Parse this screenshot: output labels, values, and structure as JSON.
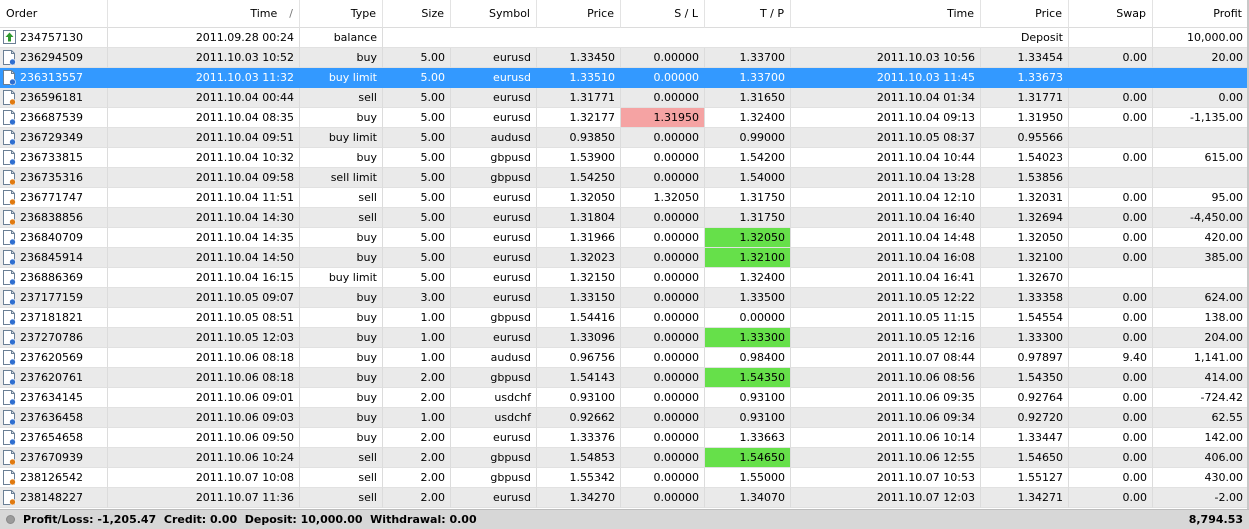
{
  "columns": {
    "order": "Order",
    "time": "Time",
    "sort_indicator": "/",
    "type": "Type",
    "size": "Size",
    "symbol": "Symbol",
    "price": "Price",
    "sl": "S / L",
    "tp": "T / P",
    "close_time": "Time",
    "close_price": "Price",
    "swap": "Swap",
    "profit": "Profit"
  },
  "rows": [
    {
      "order": "234757130",
      "time": "2011.09.28 00:24",
      "type": "balance",
      "comment": "Deposit",
      "profit": "10,000.00"
    },
    {
      "order": "236294509",
      "time": "2011.10.03 10:52",
      "type": "buy",
      "size": "5.00",
      "symbol": "eurusd",
      "price": "1.33450",
      "sl": "0.00000",
      "tp": "1.33700",
      "close_time": "2011.10.03 10:56",
      "close_price": "1.33454",
      "swap": "0.00",
      "profit": "20.00"
    },
    {
      "order": "236313557",
      "time": "2011.10.03 11:32",
      "type": "buy limit",
      "size": "5.00",
      "symbol": "eurusd",
      "price": "1.33510",
      "sl": "0.00000",
      "tp": "1.33700",
      "close_time": "2011.10.03 11:45",
      "close_price": "1.33673",
      "swap": "",
      "profit": ""
    },
    {
      "order": "236596181",
      "time": "2011.10.04 00:44",
      "type": "sell",
      "size": "5.00",
      "symbol": "eurusd",
      "price": "1.31771",
      "sl": "0.00000",
      "tp": "1.31650",
      "close_time": "2011.10.04 01:34",
      "close_price": "1.31771",
      "swap": "0.00",
      "profit": "0.00"
    },
    {
      "order": "236687539",
      "time": "2011.10.04 08:35",
      "type": "buy",
      "size": "5.00",
      "symbol": "eurusd",
      "price": "1.32177",
      "sl": "1.31950",
      "tp": "1.32400",
      "close_time": "2011.10.04 09:13",
      "close_price": "1.31950",
      "swap": "0.00",
      "profit": "-1,135.00"
    },
    {
      "order": "236729349",
      "time": "2011.10.04 09:51",
      "type": "buy limit",
      "size": "5.00",
      "symbol": "audusd",
      "price": "0.93850",
      "sl": "0.00000",
      "tp": "0.99000",
      "close_time": "2011.10.05 08:37",
      "close_price": "0.95566",
      "swap": "",
      "profit": ""
    },
    {
      "order": "236733815",
      "time": "2011.10.04 10:32",
      "type": "buy",
      "size": "5.00",
      "symbol": "gbpusd",
      "price": "1.53900",
      "sl": "0.00000",
      "tp": "1.54200",
      "close_time": "2011.10.04 10:44",
      "close_price": "1.54023",
      "swap": "0.00",
      "profit": "615.00"
    },
    {
      "order": "236735316",
      "time": "2011.10.04 09:58",
      "type": "sell limit",
      "size": "5.00",
      "symbol": "gbpusd",
      "price": "1.54250",
      "sl": "0.00000",
      "tp": "1.54000",
      "close_time": "2011.10.04 13:28",
      "close_price": "1.53856",
      "swap": "",
      "profit": ""
    },
    {
      "order": "236771747",
      "time": "2011.10.04 11:51",
      "type": "sell",
      "size": "5.00",
      "symbol": "eurusd",
      "price": "1.32050",
      "sl": "1.32050",
      "tp": "1.31750",
      "close_time": "2011.10.04 12:10",
      "close_price": "1.32031",
      "swap": "0.00",
      "profit": "95.00"
    },
    {
      "order": "236838856",
      "time": "2011.10.04 14:30",
      "type": "sell",
      "size": "5.00",
      "symbol": "eurusd",
      "price": "1.31804",
      "sl": "0.00000",
      "tp": "1.31750",
      "close_time": "2011.10.04 16:40",
      "close_price": "1.32694",
      "swap": "0.00",
      "profit": "-4,450.00"
    },
    {
      "order": "236840709",
      "time": "2011.10.04 14:35",
      "type": "buy",
      "size": "5.00",
      "symbol": "eurusd",
      "price": "1.31966",
      "sl": "0.00000",
      "tp": "1.32050",
      "close_time": "2011.10.04 14:48",
      "close_price": "1.32050",
      "swap": "0.00",
      "profit": "420.00"
    },
    {
      "order": "236845914",
      "time": "2011.10.04 14:50",
      "type": "buy",
      "size": "5.00",
      "symbol": "eurusd",
      "price": "1.32023",
      "sl": "0.00000",
      "tp": "1.32100",
      "close_time": "2011.10.04 16:08",
      "close_price": "1.32100",
      "swap": "0.00",
      "profit": "385.00"
    },
    {
      "order": "236886369",
      "time": "2011.10.04 16:15",
      "type": "buy limit",
      "size": "5.00",
      "symbol": "eurusd",
      "price": "1.32150",
      "sl": "0.00000",
      "tp": "1.32400",
      "close_time": "2011.10.04 16:41",
      "close_price": "1.32670",
      "swap": "",
      "profit": ""
    },
    {
      "order": "237177159",
      "time": "2011.10.05 09:07",
      "type": "buy",
      "size": "3.00",
      "symbol": "eurusd",
      "price": "1.33150",
      "sl": "0.00000",
      "tp": "1.33500",
      "close_time": "2011.10.05 12:22",
      "close_price": "1.33358",
      "swap": "0.00",
      "profit": "624.00"
    },
    {
      "order": "237181821",
      "time": "2011.10.05 08:51",
      "type": "buy",
      "size": "1.00",
      "symbol": "gbpusd",
      "price": "1.54416",
      "sl": "0.00000",
      "tp": "0.00000",
      "close_time": "2011.10.05 11:15",
      "close_price": "1.54554",
      "swap": "0.00",
      "profit": "138.00"
    },
    {
      "order": "237270786",
      "time": "2011.10.05 12:03",
      "type": "buy",
      "size": "1.00",
      "symbol": "eurusd",
      "price": "1.33096",
      "sl": "0.00000",
      "tp": "1.33300",
      "close_time": "2011.10.05 12:16",
      "close_price": "1.33300",
      "swap": "0.00",
      "profit": "204.00"
    },
    {
      "order": "237620569",
      "time": "2011.10.06 08:18",
      "type": "buy",
      "size": "1.00",
      "symbol": "audusd",
      "price": "0.96756",
      "sl": "0.00000",
      "tp": "0.98400",
      "close_time": "2011.10.07 08:44",
      "close_price": "0.97897",
      "swap": "9.40",
      "profit": "1,141.00"
    },
    {
      "order": "237620761",
      "time": "2011.10.06 08:18",
      "type": "buy",
      "size": "2.00",
      "symbol": "gbpusd",
      "price": "1.54143",
      "sl": "0.00000",
      "tp": "1.54350",
      "close_time": "2011.10.06 08:56",
      "close_price": "1.54350",
      "swap": "0.00",
      "profit": "414.00"
    },
    {
      "order": "237634145",
      "time": "2011.10.06 09:01",
      "type": "buy",
      "size": "2.00",
      "symbol": "usdchf",
      "price": "0.93100",
      "sl": "0.00000",
      "tp": "0.93100",
      "close_time": "2011.10.06 09:35",
      "close_price": "0.92764",
      "swap": "0.00",
      "profit": "-724.42"
    },
    {
      "order": "237636458",
      "time": "2011.10.06 09:03",
      "type": "buy",
      "size": "1.00",
      "symbol": "usdchf",
      "price": "0.92662",
      "sl": "0.00000",
      "tp": "0.93100",
      "close_time": "2011.10.06 09:34",
      "close_price": "0.92720",
      "swap": "0.00",
      "profit": "62.55"
    },
    {
      "order": "237654658",
      "time": "2011.10.06 09:50",
      "type": "buy",
      "size": "2.00",
      "symbol": "eurusd",
      "price": "1.33376",
      "sl": "0.00000",
      "tp": "1.33663",
      "close_time": "2011.10.06 10:14",
      "close_price": "1.33447",
      "swap": "0.00",
      "profit": "142.00"
    },
    {
      "order": "237670939",
      "time": "2011.10.06 10:24",
      "type": "sell",
      "size": "2.00",
      "symbol": "gbpusd",
      "price": "1.54853",
      "sl": "0.00000",
      "tp": "1.54650",
      "close_time": "2011.10.06 12:55",
      "close_price": "1.54650",
      "swap": "0.00",
      "profit": "406.00"
    },
    {
      "order": "238126542",
      "time": "2011.10.07 10:08",
      "type": "sell",
      "size": "2.00",
      "symbol": "gbpusd",
      "price": "1.55342",
      "sl": "0.00000",
      "tp": "1.55000",
      "close_time": "2011.10.07 10:53",
      "close_price": "1.55127",
      "swap": "0.00",
      "profit": "430.00"
    },
    {
      "order": "238148227",
      "time": "2011.10.07 11:36",
      "type": "sell",
      "size": "2.00",
      "symbol": "eurusd",
      "price": "1.34270",
      "sl": "0.00000",
      "tp": "1.34070",
      "close_time": "2011.10.07 12:03",
      "close_price": "1.34271",
      "swap": "0.00",
      "profit": "-2.00"
    }
  ],
  "footer": {
    "summary": "Profit/Loss: -1,205.47  Credit: 0.00  Deposit: 10,000.00  Withdrawal: 0.00",
    "total": "8,794.53"
  },
  "colors": {
    "selected_row": "#3399ff",
    "stop_loss_hit": "#f5a3a3",
    "take_profit_hit": "#66e04a",
    "alt_row": "#eaeaea"
  },
  "icons": {
    "balance": "balance-deposit-icon",
    "buy": "order-document-buy-icon",
    "sell": "order-document-sell-icon"
  }
}
